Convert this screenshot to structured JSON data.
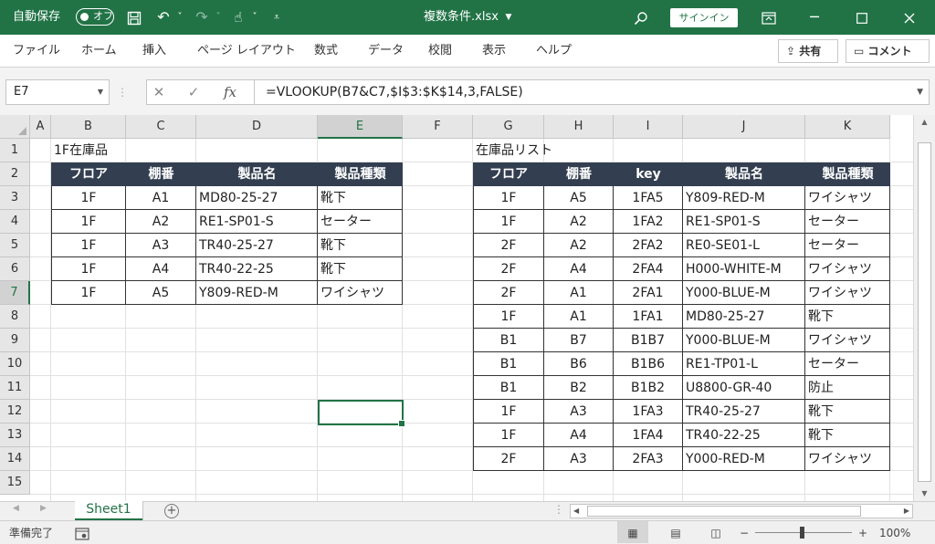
{
  "titlebar": {
    "autosave_label": "自動保存",
    "autosave_state": "オフ",
    "filename": "複数条件.xlsx",
    "signin": "サインイン",
    "icons": [
      "save-icon",
      "undo-icon",
      "redo-icon",
      "touch-mode-icon",
      "customize-icon",
      "search-icon",
      "ribbon-display-icon",
      "minimize-icon",
      "maximize-icon",
      "close-icon"
    ]
  },
  "ribbon": {
    "tabs": [
      "ファイル",
      "ホーム",
      "挿入",
      "ページ レイアウト",
      "数式",
      "データ",
      "校閲",
      "表示",
      "ヘルプ"
    ],
    "share": "共有",
    "comment": "コメント"
  },
  "formula_bar": {
    "name_box": "E7",
    "fx": "fx",
    "formula": "=VLOOKUP(B7&C7,$I$3:$K$14,3,FALSE)"
  },
  "grid": {
    "columns": [
      "A",
      "B",
      "C",
      "D",
      "E",
      "F",
      "G",
      "H",
      "I",
      "J",
      "K"
    ],
    "selected_column": "E",
    "rows": [
      "1",
      "2",
      "3",
      "4",
      "5",
      "6",
      "7",
      "8",
      "9",
      "10",
      "11",
      "12",
      "13",
      "14",
      "15"
    ],
    "selected_row": "7",
    "header_fill": "#333f50",
    "accent": "#217346"
  },
  "table1": {
    "title": "1F在庫品",
    "headers": [
      "フロア",
      "棚番",
      "製品名",
      "製品種類"
    ],
    "rows": [
      [
        "1F",
        "A1",
        "MD80-25-27",
        "靴下"
      ],
      [
        "1F",
        "A2",
        "RE1-SP01-S",
        "セーター"
      ],
      [
        "1F",
        "A3",
        "TR40-25-27",
        "靴下"
      ],
      [
        "1F",
        "A4",
        "TR40-22-25",
        "靴下"
      ],
      [
        "1F",
        "A5",
        "Y809-RED-M",
        "ワイシャツ"
      ]
    ]
  },
  "table2": {
    "title": "在庫品リスト",
    "headers": [
      "フロア",
      "棚番",
      "key",
      "製品名",
      "製品種類"
    ],
    "rows": [
      [
        "1F",
        "A5",
        "1FA5",
        "Y809-RED-M",
        "ワイシャツ"
      ],
      [
        "1F",
        "A2",
        "1FA2",
        "RE1-SP01-S",
        "セーター"
      ],
      [
        "2F",
        "A2",
        "2FA2",
        "RE0-SE01-L",
        "セーター"
      ],
      [
        "2F",
        "A4",
        "2FA4",
        "H000-WHITE-M",
        "ワイシャツ"
      ],
      [
        "2F",
        "A1",
        "2FA1",
        "Y000-BLUE-M",
        "ワイシャツ"
      ],
      [
        "1F",
        "A1",
        "1FA1",
        "MD80-25-27",
        "靴下"
      ],
      [
        "B1",
        "B7",
        "B1B7",
        "Y000-BLUE-M",
        "ワイシャツ"
      ],
      [
        "B1",
        "B6",
        "B1B6",
        "RE1-TP01-L",
        "セーター"
      ],
      [
        "B1",
        "B2",
        "B1B2",
        "U8800-GR-40",
        "防止"
      ],
      [
        "1F",
        "A3",
        "1FA3",
        "TR40-25-27",
        "靴下"
      ],
      [
        "1F",
        "A4",
        "1FA4",
        "TR40-22-25",
        "靴下"
      ],
      [
        "2F",
        "A3",
        "2FA3",
        "Y000-RED-M",
        "ワイシャツ"
      ]
    ]
  },
  "sheet_tabs": [
    "Sheet1"
  ],
  "status": {
    "ready": "準備完了",
    "zoom": "100%"
  }
}
